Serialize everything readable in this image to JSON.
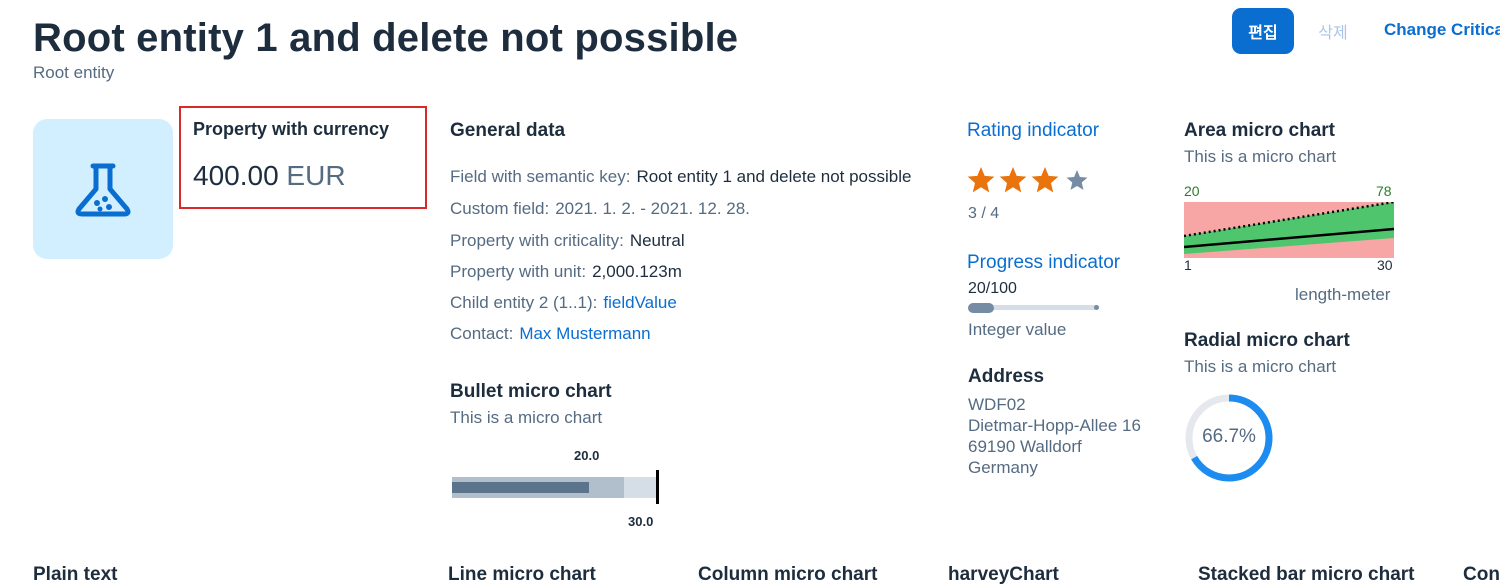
{
  "header": {
    "title": "Root entity 1 and delete not possible",
    "subtitle": "Root entity",
    "edit_label": "편집",
    "delete_label": "삭제",
    "change_label": "Change Critical"
  },
  "kpi": {
    "label": "Property with currency",
    "amount": "400.00",
    "currency": "EUR"
  },
  "general": {
    "heading": "General data",
    "fields": [
      {
        "label": "Field with semantic key:",
        "value": "Root entity 1 and delete not possible"
      },
      {
        "label": "Custom field:",
        "value": "2021. 1. 2. - 2021. 12. 28."
      },
      {
        "label": "Property with criticality:",
        "value": "Neutral"
      },
      {
        "label": "Property with unit:",
        "value": "2,000.123m"
      },
      {
        "label": "Child entity 2 (1..1):",
        "value": "fieldValue"
      },
      {
        "label": "Contact:",
        "value": "Max Mustermann"
      }
    ]
  },
  "bullet": {
    "heading": "Bullet micro chart",
    "subtitle": "This is a micro chart",
    "target_label": "20.0",
    "actual_label": "30.0",
    "value": 20,
    "target": 30,
    "range_max": 30
  },
  "rating": {
    "heading": "Rating indicator",
    "value": 3,
    "max": 4,
    "text": "3 / 4"
  },
  "progress": {
    "heading": "Progress indicator",
    "text": "20/100",
    "percent": 20,
    "caption": "Integer value"
  },
  "address": {
    "heading": "Address",
    "lines": [
      "WDF02",
      "Dietmar-Hopp-Allee 16",
      "69190 Walldorf",
      "Germany"
    ]
  },
  "area_chart": {
    "heading": "Area micro chart",
    "subtitle": "This is a micro chart",
    "top_left": "20",
    "top_right": "78",
    "bottom_left": "1",
    "bottom_right": "30",
    "unit": "length-meter"
  },
  "radial_chart": {
    "heading": "Radial micro chart",
    "subtitle": "This is a micro chart",
    "percent": 66.7,
    "text": "66.7%"
  },
  "bottom_sections": [
    "Plain text",
    "Line micro chart",
    "Column micro chart",
    "harveyChart",
    "Stacked bar micro chart",
    "Con"
  ],
  "colors": {
    "brand": "#0a6ed1",
    "star_on": "#e9730c",
    "star_off": "#758ca4",
    "error": "#d92a2a",
    "area_bad": "#f7a5a5",
    "area_good": "#4fc66d"
  }
}
